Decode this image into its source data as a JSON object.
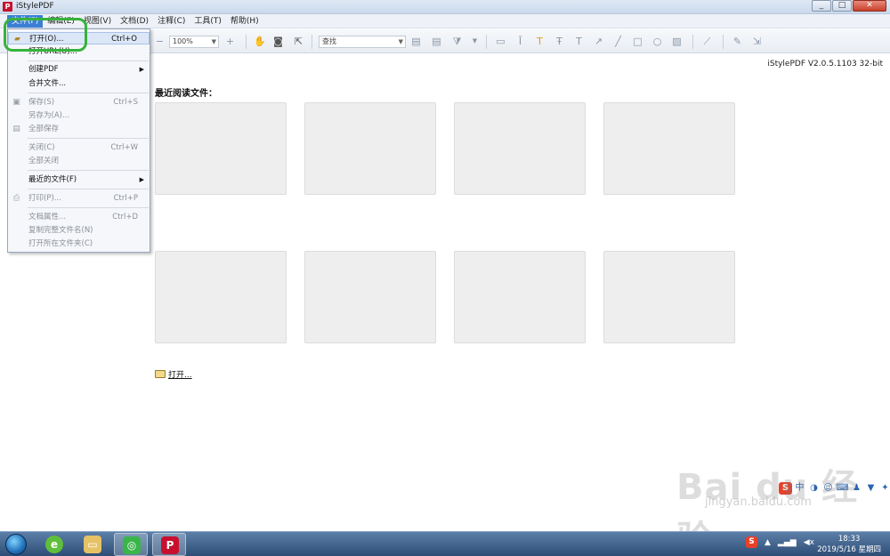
{
  "window": {
    "title": "iStylePDF",
    "logo_text": "P",
    "controls": [
      "_",
      "□",
      "✕"
    ]
  },
  "menubar": {
    "items": [
      "文件(F)",
      "编辑(E)",
      "视图(V)",
      "文档(D)",
      "注释(C)",
      "工具(T)",
      "帮助(H)"
    ],
    "active_index": 0
  },
  "toolbar": {
    "zoom_value": "100%",
    "find_placeholder": "查找"
  },
  "content": {
    "version": "iStylePDF V2.0.5.1103 32-bit",
    "recent_title": "最近阅读文件：",
    "open_link": "打开..."
  },
  "file_menu": {
    "open": {
      "label": "打开(O)...",
      "shortcut": "Ctrl+O"
    },
    "open_url": {
      "label": "打开URL(U)..."
    },
    "create_pdf": {
      "label": "创建PDF"
    },
    "merge": {
      "label": "合并文件..."
    },
    "save": {
      "label": "保存(S)",
      "shortcut": "Ctrl+S"
    },
    "save_as": {
      "label": "另存为(A)..."
    },
    "save_all": {
      "label": "全部保存"
    },
    "close": {
      "label": "关闭(C)",
      "shortcut": "Ctrl+W"
    },
    "close_all": {
      "label": "全部关闭"
    },
    "recent": {
      "label": "最近的文件(F)"
    },
    "print": {
      "label": "打印(P)...",
      "shortcut": "Ctrl+P"
    },
    "properties": {
      "label": "文档属性...",
      "shortcut": "Ctrl+D"
    },
    "copy_name": {
      "label": "复制完整文件名(N)"
    },
    "open_folder": {
      "label": "打开所在文件夹(C)"
    }
  },
  "watermark": {
    "logo": "Bai du 经验",
    "url": "jingyan.baidu.com"
  },
  "taskbar": {
    "clock_time": "18:33",
    "clock_date": "2019/5/16 星期四",
    "apps": [
      "browser",
      "explorer",
      "wechat",
      "istylepdf"
    ]
  }
}
